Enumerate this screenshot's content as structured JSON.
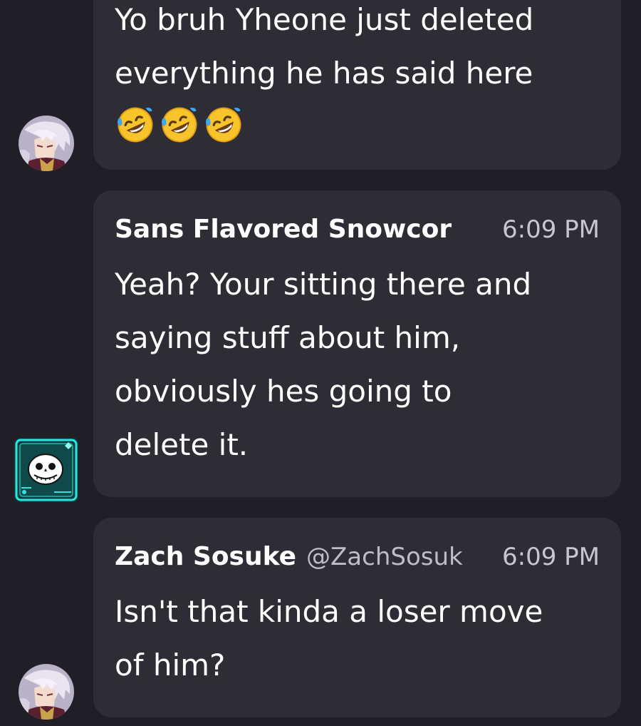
{
  "messages": [
    {
      "author": "",
      "handle": "",
      "time": "",
      "lines": [
        "Yo bruh Yheone just deleted",
        "everything he has said here"
      ],
      "emoji": [
        "rolling-on-floor-laughing-emoji",
        "rolling-on-floor-laughing-emoji",
        "rolling-on-floor-laughing-emoji"
      ],
      "avatar": "white-haired-anime-avatar"
    },
    {
      "author": "Sans Flavored Snowcor",
      "handle": "",
      "time": "6:09 PM",
      "lines": [
        "Yeah? Your sitting there and",
        "saying stuff about him,",
        "obviously hes going to",
        "delete it."
      ],
      "avatar": "skull-badge-avatar"
    },
    {
      "author": "Zach Sosuke",
      "handle": "@ZachSosuk",
      "time": "6:09 PM",
      "lines": [
        "Isn't that kinda a loser move",
        "of him?"
      ],
      "avatar": "white-haired-anime-avatar"
    }
  ],
  "colors": {
    "background": "#211f26",
    "bubble": "#2e2c35",
    "text": "#ffffff",
    "muted": "#c8c6ce",
    "badge_accent": "#2ee6e0"
  }
}
